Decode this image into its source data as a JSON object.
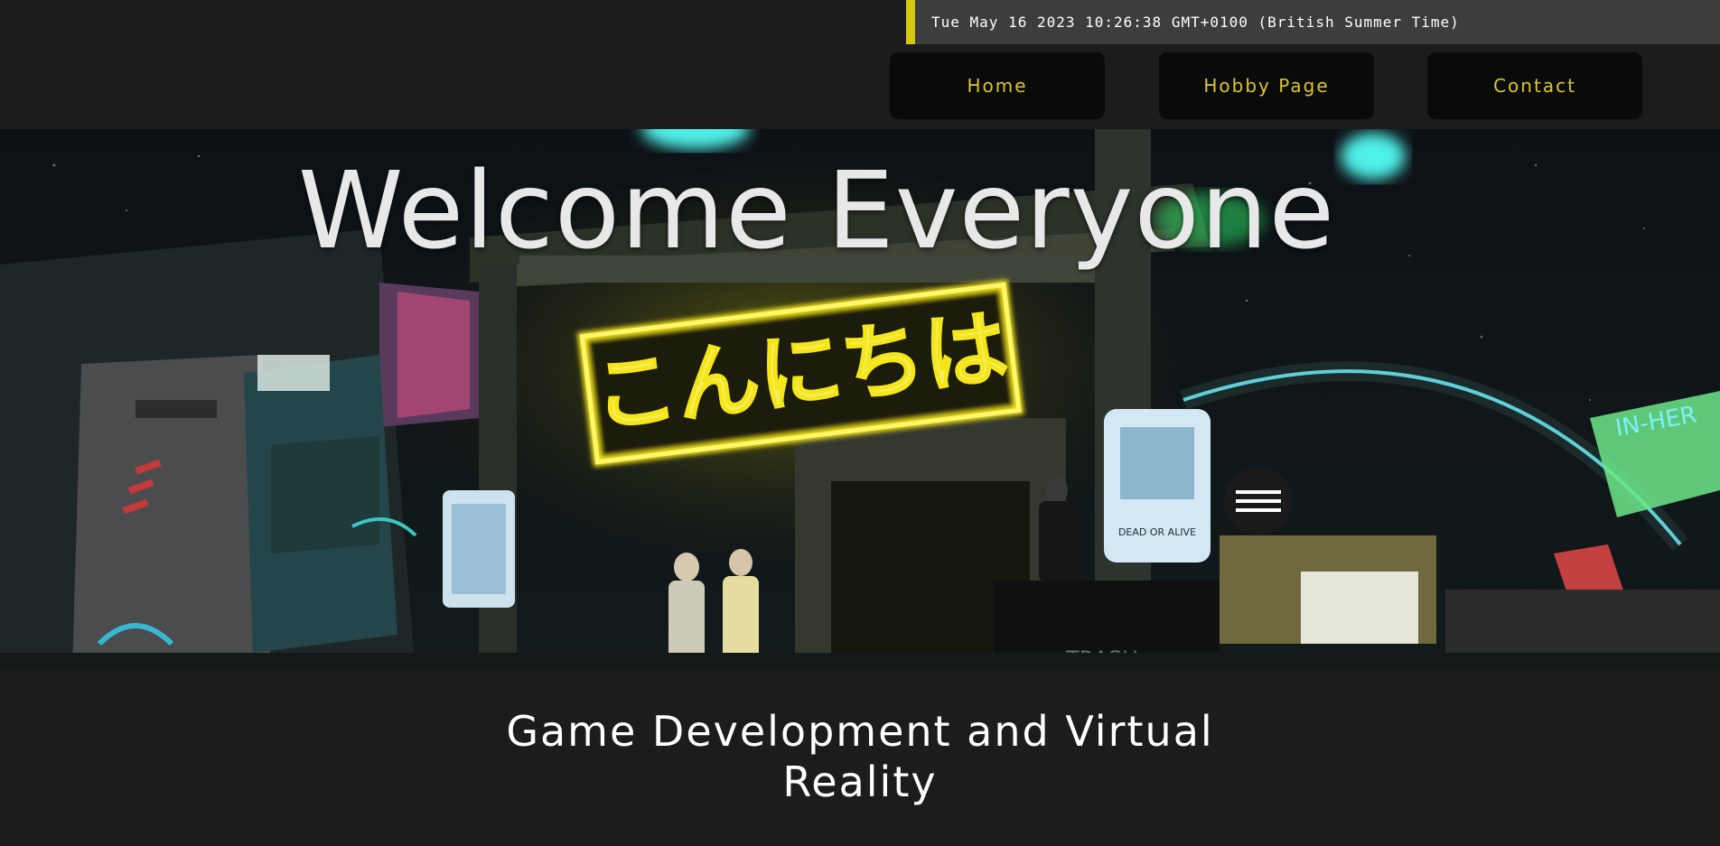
{
  "header": {
    "datetime": "Tue May 16 2023 10:26:38 GMT+0100 (British Summer Time)",
    "nav": {
      "home": "Home",
      "hobby": "Hobby Page",
      "contact": "Contact"
    }
  },
  "hero": {
    "title": "Welcome Everyone",
    "sign_text": "こんにちは",
    "poster_text": "DEAD OR ALIVE",
    "trash_text": "TRASH",
    "shop_text": "IN-HER"
  },
  "subtitle": {
    "line1": "Game Development and Virtual",
    "line2": "Reality"
  },
  "colors": {
    "accent": "#d4c814",
    "nav_text": "#d9c72a",
    "neon_yellow": "#f5e61a",
    "neon_cyan": "#4ff0e8",
    "background": "#1c1c1c"
  }
}
